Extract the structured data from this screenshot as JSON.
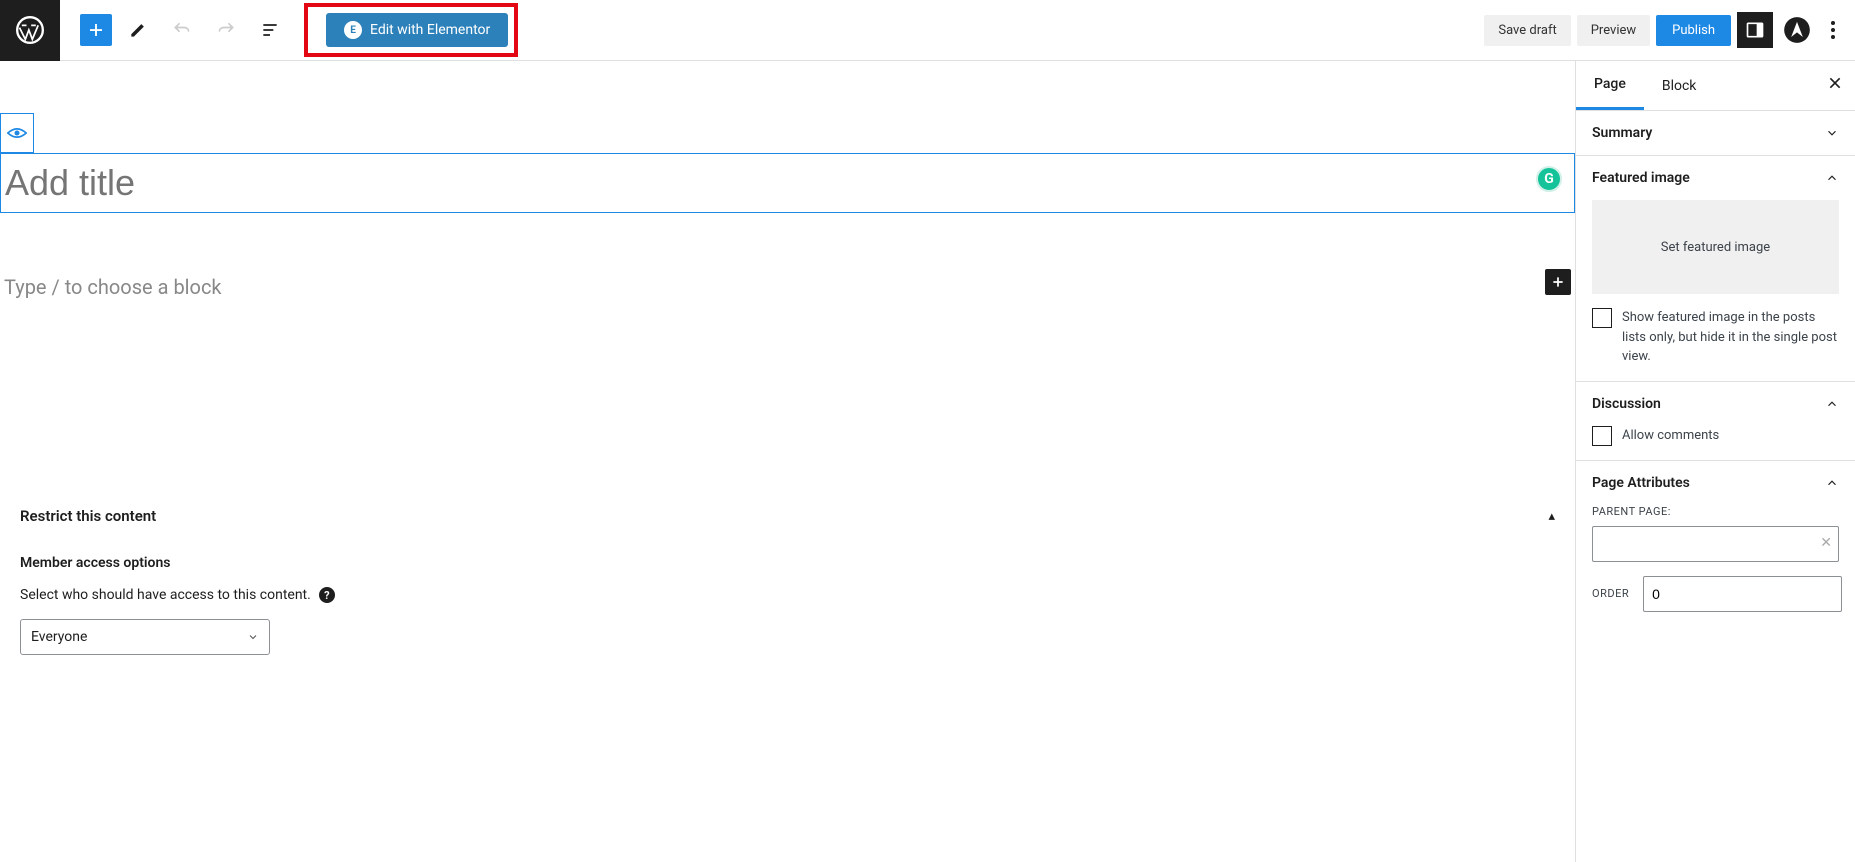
{
  "toolbar": {
    "elementor_label": "Edit with Elementor",
    "save_draft": "Save draft",
    "preview": "Preview",
    "publish": "Publish"
  },
  "editor": {
    "title_placeholder": "Add title",
    "content_placeholder": "Type / to choose a block"
  },
  "restrict": {
    "header": "Restrict this content",
    "member_options": "Member access options",
    "desc": "Select who should have access to this content.",
    "select_value": "Everyone"
  },
  "sidebar": {
    "tabs": {
      "page": "Page",
      "block": "Block"
    },
    "summary": {
      "title": "Summary"
    },
    "featured": {
      "title": "Featured image",
      "placeholder": "Set featured image",
      "checkbox_label": "Show featured image in the posts lists only, but hide it in the single post view."
    },
    "discussion": {
      "title": "Discussion",
      "allow_comments": "Allow comments"
    },
    "attributes": {
      "title": "Page Attributes",
      "parent_label": "PARENT PAGE:",
      "order_label": "ORDER",
      "order_value": "0"
    }
  }
}
